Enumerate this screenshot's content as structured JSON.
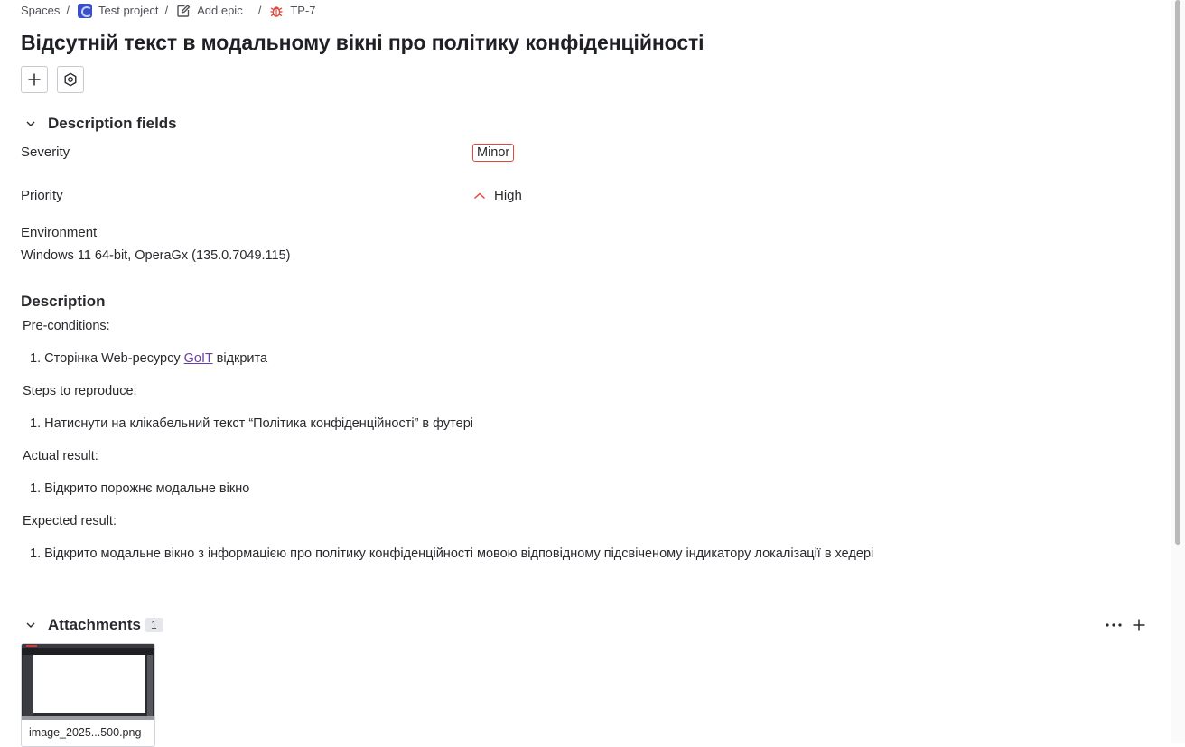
{
  "breadcrumb": {
    "spaces": "Spaces",
    "project": "Test project",
    "add_epic": "Add epic",
    "issue_key": "TP-7",
    "separator": "/"
  },
  "title": "Відсутній текст в модальному вікні про політику конфіденційності",
  "toolbar": {
    "add_icon": "plus-icon",
    "settings_icon": "gear-icon"
  },
  "description_fields": {
    "header": "Description fields",
    "severity_label": "Severity",
    "severity_value": "Minor",
    "priority_label": "Priority",
    "priority_value": "High",
    "environment_label": "Environment",
    "environment_value": "Windows 11 64-bit, OperaGx (135.0.7049.115)"
  },
  "description": {
    "header": "Description",
    "preconditions_label": "Pre-conditions:",
    "pre_item_num": "1.",
    "pre_item_before": "Сторінка Web-ресурсу ",
    "pre_item_link": "GoIT",
    "pre_item_after": " відкрита",
    "steps_label": "Steps to reproduce:",
    "steps_item_num": "1.",
    "steps_item": "Натиснути на клікабельний текст “Політика конфіденційності” в футері",
    "actual_label": "Actual result:",
    "actual_item_num": "1.",
    "actual_item": "Відкрито порожнє модальне вікно",
    "expected_label": "Expected result:",
    "expected_item_num": "1.",
    "expected_item": "Відкрито модальне вікно з інформацією про політику конфіденційності мовою відповідному підсвіченому індикатору локалізації в хедері"
  },
  "attachments": {
    "header": "Attachments",
    "count": "1",
    "file_name": "image_2025...500.png"
  },
  "colors": {
    "severity_border": "#e2483d",
    "priority_icon": "#e2483d",
    "link": "#6c3fa8",
    "bug_icon": "#e2483d",
    "project_icon": "#3b50c8"
  }
}
